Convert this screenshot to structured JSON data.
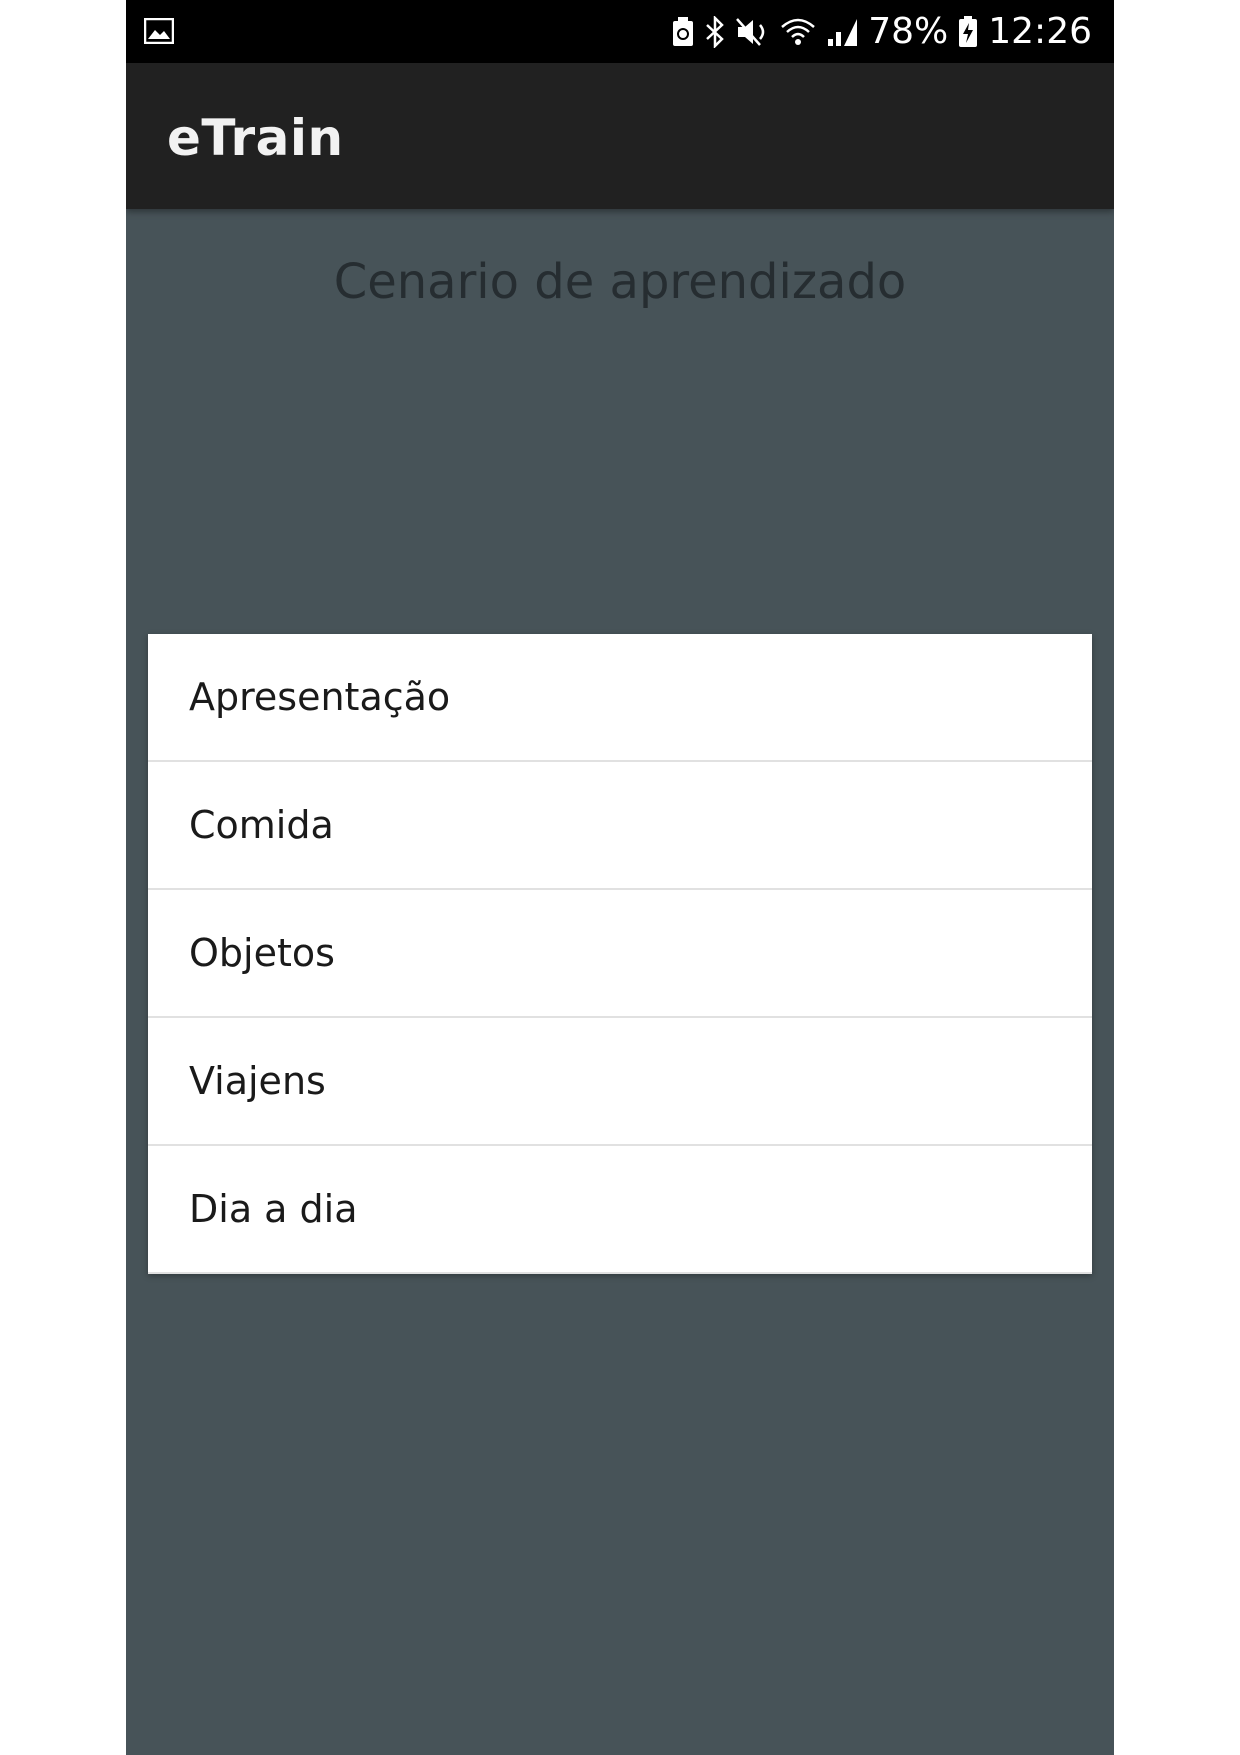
{
  "status_bar": {
    "battery_percent": "78%",
    "time": "12:26",
    "icons": [
      "image-icon",
      "recycle-icon",
      "bluetooth-icon",
      "mute-icon",
      "wifi-icon",
      "signal-icon",
      "battery-icon"
    ]
  },
  "app_bar": {
    "title": "eTrain"
  },
  "main": {
    "title": "Cenario de aprendizado"
  },
  "dialog": {
    "items": [
      {
        "label": "Apresentação"
      },
      {
        "label": "Comida"
      },
      {
        "label": "Objetos"
      },
      {
        "label": "Viajens"
      },
      {
        "label": "Dia a dia"
      }
    ]
  },
  "colors": {
    "status_bar": "#000000",
    "app_bar": "#212121",
    "background": "#475358",
    "dialog": "#ffffff",
    "divider": "#e1e1e1"
  }
}
